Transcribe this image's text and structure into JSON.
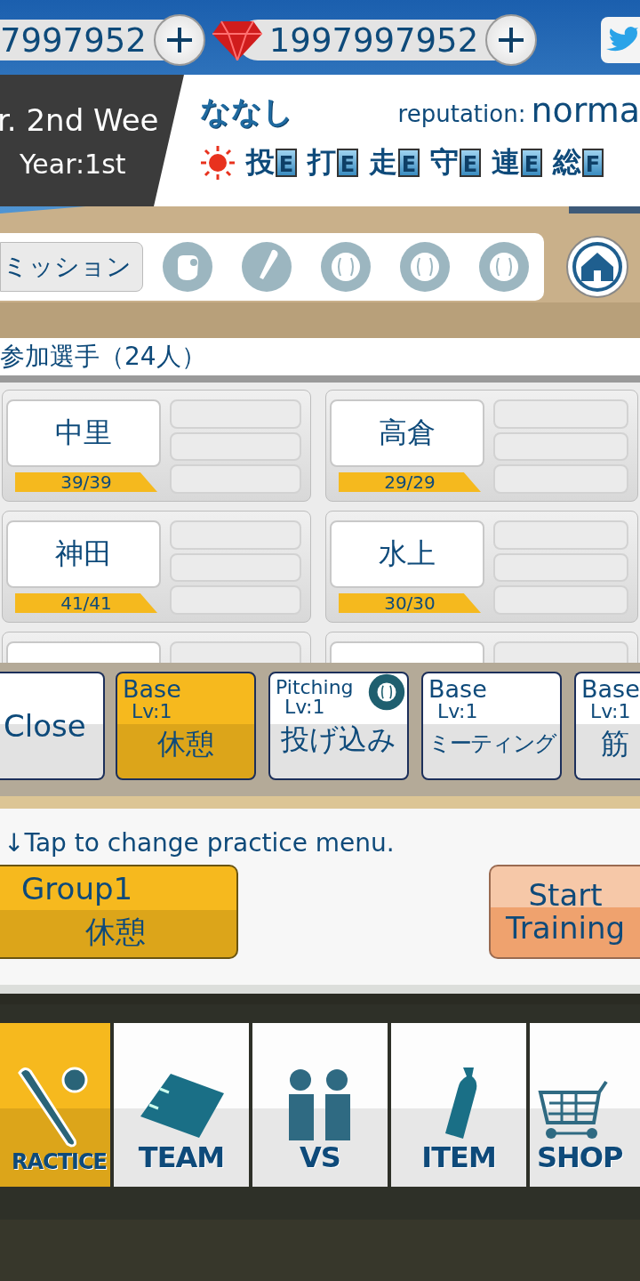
{
  "currencies": [
    {
      "amount": "7997952",
      "gem": false
    },
    {
      "amount": "1997997952",
      "gem": true
    }
  ],
  "status": {
    "week": "r. 2nd Wee",
    "year": "Year:1st",
    "name": "ななし",
    "reputation_label": "reputation:",
    "reputation": "norma",
    "ratings": [
      {
        "label": "投",
        "grade": "E"
      },
      {
        "label": "打",
        "grade": "E"
      },
      {
        "label": "走",
        "grade": "E"
      },
      {
        "label": "守",
        "grade": "E"
      },
      {
        "label": "連",
        "grade": "E"
      },
      {
        "label": "総",
        "grade": "F"
      }
    ]
  },
  "mission": {
    "label": "ミッション",
    "slots": [
      {
        "kind": "glove"
      },
      {
        "kind": "bat"
      },
      {
        "kind": "ball"
      },
      {
        "kind": "ball"
      },
      {
        "kind": "ball"
      }
    ]
  },
  "roster": {
    "title": "参加選手（24人）",
    "players": [
      {
        "name": "中里",
        "stamina": "39/39"
      },
      {
        "name": "高倉",
        "stamina": "29/29"
      },
      {
        "name": "神田",
        "stamina": "41/41"
      },
      {
        "name": "水上",
        "stamina": "30/30"
      }
    ]
  },
  "practice_menu": {
    "close": "Close",
    "items": [
      {
        "category": "Base",
        "level": "Lv:1",
        "name": "休憩",
        "selected": true,
        "badge": false
      },
      {
        "category": "Pitching",
        "level": "Lv:1",
        "name": "投げ込み",
        "selected": false,
        "badge": true
      },
      {
        "category": "Base",
        "level": "Lv:1",
        "name": "ミーティング",
        "selected": false,
        "badge": false
      },
      {
        "category": "Base",
        "level": "Lv:1",
        "name": "筋",
        "selected": false,
        "badge": false
      }
    ]
  },
  "hint": "↓Tap to change practice menu.",
  "group": {
    "label": "Group1",
    "menu": "休憩"
  },
  "start": "Start Training",
  "nav": [
    {
      "label": "RACTICE",
      "kind": "practice",
      "selected": true
    },
    {
      "label": "TEAM",
      "kind": "team",
      "selected": false
    },
    {
      "label": "VS",
      "kind": "vs",
      "selected": false
    },
    {
      "label": "ITEM",
      "kind": "item",
      "selected": false
    },
    {
      "label": "SHOP",
      "kind": "shop",
      "selected": false
    }
  ]
}
